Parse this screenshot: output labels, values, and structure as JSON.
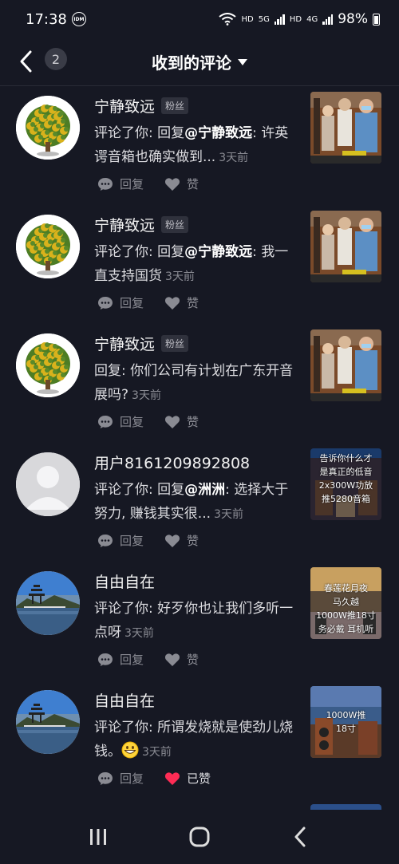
{
  "status_bar": {
    "time": "17:38",
    "idm": "IDM",
    "hd1": "HD",
    "net1": "5G",
    "hd2": "HD",
    "net2": "4G",
    "battery": "98%"
  },
  "header": {
    "back_icon": "chevron-left-icon",
    "count": "2",
    "title": "收到的评论",
    "dropdown_icon": "caret-down-icon"
  },
  "actions": {
    "reply": "回复",
    "like": "赞",
    "liked": "已赞"
  },
  "comments": [
    {
      "user": "宁静致远",
      "badge": "粉丝",
      "prefix": "评论了你: 回复",
      "mention": "@宁静致远",
      "suffix": ": 许英谔音箱也确实做到...",
      "time": "3天前",
      "liked": false,
      "avatar": "osmanthus-tree",
      "thumb_text": ""
    },
    {
      "user": "宁静致远",
      "badge": "粉丝",
      "prefix": "评论了你: 回复",
      "mention": "@宁静致远",
      "suffix": ": 我一直支持国货",
      "time": "3天前",
      "liked": false,
      "avatar": "osmanthus-tree",
      "thumb_text": ""
    },
    {
      "user": "宁静致远",
      "badge": "粉丝",
      "prefix": "回复: 你们公司有计划在广东开音展吗?",
      "mention": "",
      "suffix": "",
      "time": "3天前",
      "liked": false,
      "avatar": "osmanthus-tree",
      "thumb_text": ""
    },
    {
      "user": "用户8161209892808",
      "badge": "",
      "prefix": "评论了你: 回复",
      "mention": "@洲洲",
      "suffix": ": 选择大于努力, 赚钱其实很...",
      "time": "3天前",
      "liked": false,
      "avatar": "default-person",
      "thumb_text": "告诉你什么才\n是真正的低音\n2x300W功放\n推5280音箱"
    },
    {
      "user": "自由自在",
      "badge": "",
      "prefix": "评论了你: 好歹你也让我们多听一点呀",
      "mention": "",
      "suffix": "",
      "time": "3天前",
      "liked": false,
      "avatar": "pavilion-lake",
      "thumb_text": "春莲花月夜\n马久越\n1000W推18寸\n务必戴 耳机听"
    },
    {
      "user": "自由自在",
      "badge": "",
      "prefix": "评论了你: 所谓发烧就是使劲儿烧钱。",
      "mention": "",
      "suffix": "",
      "time": "3天前",
      "liked": true,
      "emoji": "grinning-face-icon",
      "avatar": "pavilion-lake",
      "thumb_text": "1000W推\n18寸"
    }
  ],
  "navbar": {
    "recent": "recent-apps-icon",
    "home": "home-icon",
    "back": "back-icon"
  }
}
